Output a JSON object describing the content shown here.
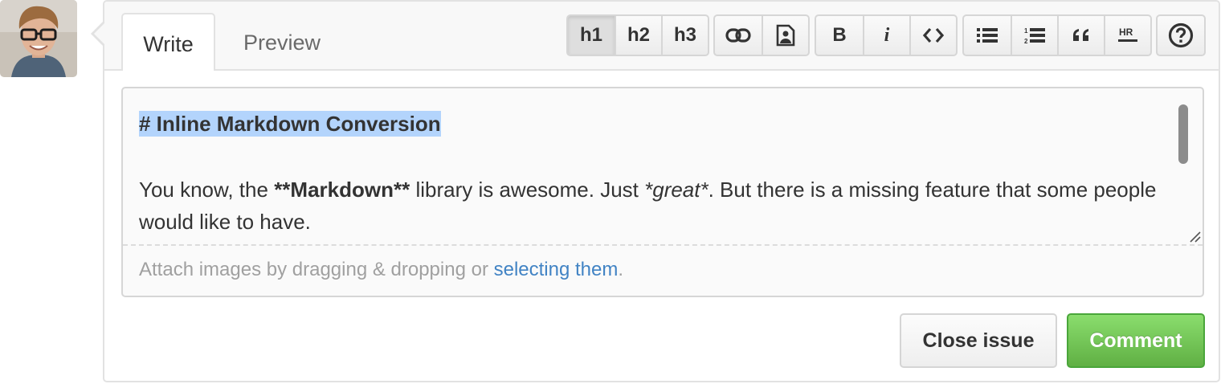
{
  "avatar": {
    "icon": "user-avatar-photo"
  },
  "tabs": [
    {
      "label": "Write",
      "active": true
    },
    {
      "label": "Preview",
      "active": false
    }
  ],
  "toolbar": {
    "h1": "h1",
    "h2": "h2",
    "h3": "h3",
    "bold": "B",
    "italic": "i",
    "link_icon": "link-icon",
    "image_icon": "image-icon",
    "code_icon": "code-icon",
    "ul_icon": "unordered-list-icon",
    "ol_icon": "ordered-list-icon",
    "quote_icon": "quote-icon",
    "hr_icon": "horizontal-rule-icon",
    "help_icon": "help-icon",
    "pressed": "h1"
  },
  "editor": {
    "line1": "# Inline Markdown Conversion",
    "para_part1": "You know, the ",
    "para_bold": "**Markdown**",
    "para_part2": " library is awesome. Just ",
    "para_italic": "*great*",
    "para_part3": ". But there is a missing feature that some people would like to have.",
    "attach_text": "Attach images by dragging & dropping or ",
    "attach_link": "selecting them",
    "attach_end": "."
  },
  "actions": {
    "close_label": "Close issue",
    "comment_label": "Comment"
  },
  "colors": {
    "accent_link": "#4183c4",
    "comment_green": "#60b044",
    "selection": "#b3d4fc"
  }
}
